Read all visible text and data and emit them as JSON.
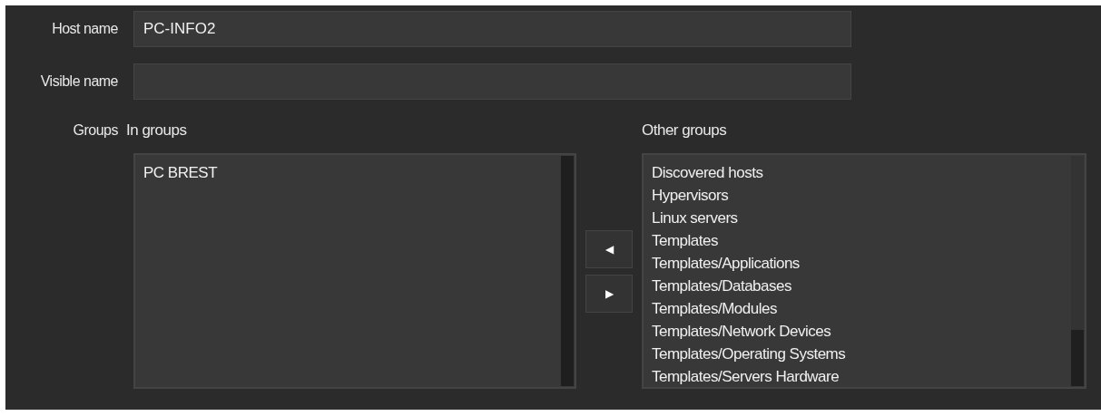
{
  "fields": [
    {
      "label": "Host name",
      "value": "PC-INFO2"
    },
    {
      "label": "Visible name"
    }
  ],
  "groups": {
    "label": "Groups",
    "in_groups": {
      "heading": "In groups",
      "items": [
        "PC BREST"
      ]
    },
    "move_buttons": [
      "◀",
      "▶"
    ],
    "other_groups": {
      "heading": "Other groups",
      "items": [
        "Discovered hosts",
        "Hypervisors",
        "Linux servers",
        "Templates",
        "Templates/Applications",
        "Templates/Databases",
        "Templates/Modules",
        "Templates/Network Devices",
        "Templates/Operating Systems",
        "Templates/Servers Hardware"
      ]
    }
  }
}
